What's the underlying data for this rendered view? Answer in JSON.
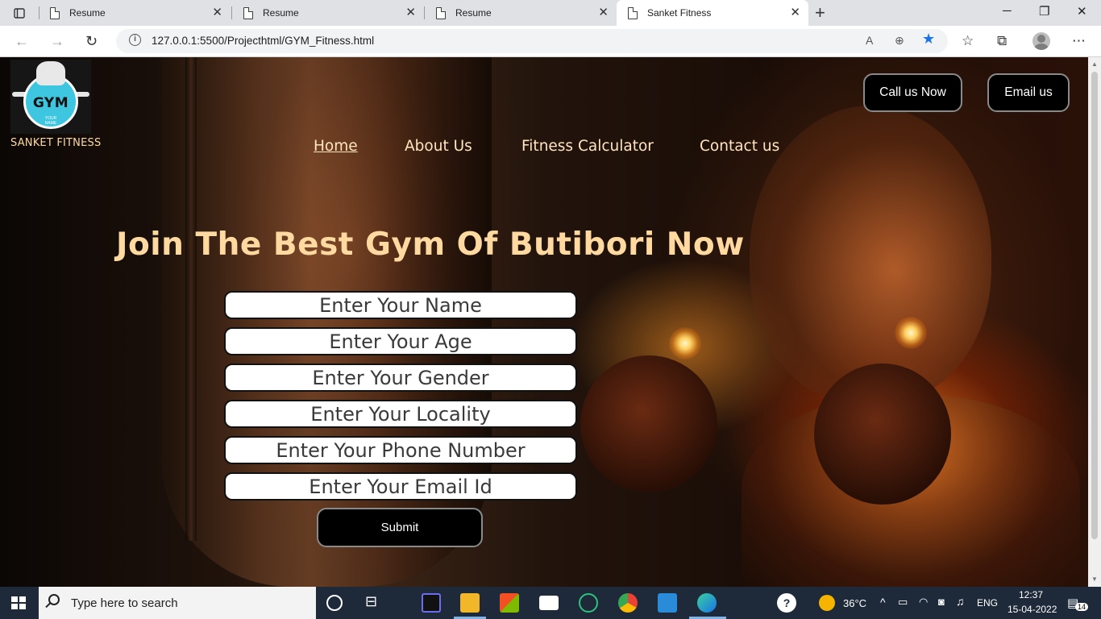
{
  "browser": {
    "tabs": [
      {
        "title": "Resume",
        "active": false
      },
      {
        "title": "Resume",
        "active": false
      },
      {
        "title": "Resume",
        "active": false
      },
      {
        "title": "Sanket Fitness",
        "active": true
      }
    ],
    "url": "127.0.0.1:5500/Projecthtml/GYM_Fitness.html",
    "close_glyph": "✕",
    "new_tab_glyph": "+"
  },
  "site": {
    "logo_text": "GYM",
    "logo_subtext": "YOUR NAME",
    "brand": "SANKET FITNESS",
    "call_button": "Call us Now",
    "email_button": "Email us",
    "nav": [
      {
        "label": "Home",
        "active": true
      },
      {
        "label": "About Us",
        "active": false
      },
      {
        "label": "Fitness Calculator",
        "active": false
      },
      {
        "label": "Contact us",
        "active": false
      }
    ],
    "hero_title": "Join The Best Gym Of Butibori Now",
    "form": {
      "name_placeholder": "Enter Your Name",
      "age_placeholder": "Enter Your Age",
      "gender_placeholder": "Enter Your Gender",
      "locality_placeholder": "Enter Your Locality",
      "phone_placeholder": "Enter Your Phone Number",
      "email_placeholder": "Enter Your Email Id",
      "submit_label": "Submit"
    }
  },
  "taskbar": {
    "search_placeholder": "Type here to search",
    "weather": "36°C",
    "language": "ENG",
    "time": "12:37",
    "date": "15-04-2022",
    "notifications": "14"
  },
  "colors": {
    "accent_text": "#ffd9a0",
    "button_bg": "#000000",
    "taskbar_bg": "#1e2a3a"
  }
}
